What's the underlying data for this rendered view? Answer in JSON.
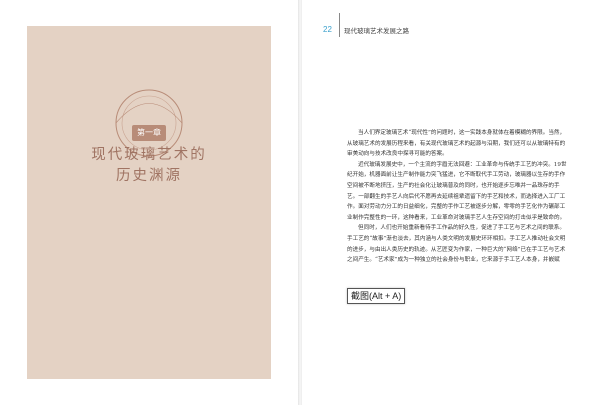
{
  "left_page": {
    "chapter_badge": "第一章",
    "chapter_title": "现代玻璃艺术的",
    "chapter_subtitle": "历史渊源"
  },
  "right_page": {
    "page_number": "22",
    "running_header": "现代玻璃艺术发展之路",
    "paragraphs": [
      "当人们界定玻璃艺术“现代性”的问题时，这一实践本身就体在着模糊的界限。当然，从玻璃艺术的发展历程来看，有关现代玻璃艺术的起源与沿期，我们还可以从玻璃特有的审美动向与技术改良中探寻可能的答案。",
      "近代玻璃发展史中，一个主流的字眉无法回避：工业革命与传统手工艺的冲突。19世纪开始，机器面前让生产制作能力突飞猛进，它不断取代手工劳动，玻璃器以生存的手作空间被不断地挤压，生产的社会化让玻璃普及的同时，也开始逐步忘唯并一品珠存的手艺。一部翻生的手艺人向后代不愿再去延续祖辈遗留下的手艺和技术，而选择进入工厂工作。面对劳动力分工的日益细化，完整的手作工艺被逐步分解，零零的手艺化作为碾部工业制作完整性的一环，这种看来，工业革命对玻璃手艺人生存空间的打击似乎是致命的。",
      "但同时，人们也开始重新看待手工作品的好久性，促进了手工艺与艺术之间的联系。手工艺的“故事”渐也淡去，其内涵与人类文明的发展史环环相扣。手工艺人推动社会文明的进步，与由出人类历史的轨迹。从艺匠变为作家，一种巨大的“网络”已在手工艺与艺术之间产生。“艺术家”成为一种独立的社会身份与职业，它来源于手工艺人本身，并嵌赋"
    ]
  },
  "overlay": {
    "screenshot_tooltip": "截图(Alt + A)"
  },
  "colors": {
    "panel_background": "#e4d2c4",
    "chapter_text": "#a07463",
    "badge_background": "#b88c78",
    "page_number": "#3aa0cc"
  },
  "icons": {
    "chapter_ornament": "circle-ornament-icon"
  }
}
